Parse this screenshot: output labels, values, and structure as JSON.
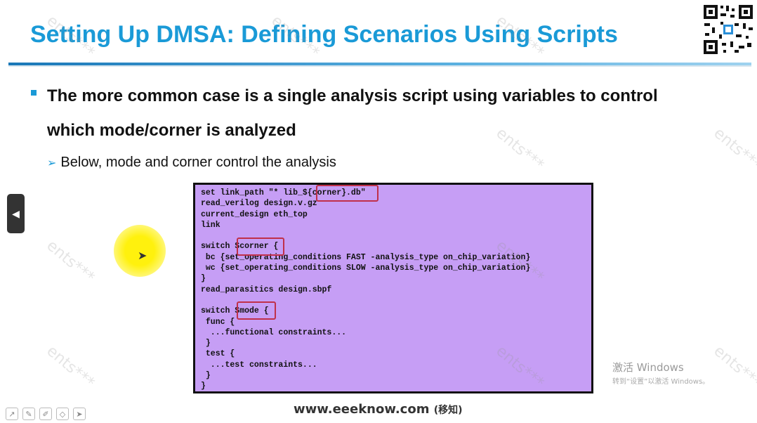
{
  "slide": {
    "title": "Setting Up DMSA: Defining Scenarios Using Scripts",
    "bullet_main": "The more common case is a single analysis script using variables to control which mode/corner is analyzed",
    "sub_bullet": "Below, mode and corner control the analysis"
  },
  "code_lines": [
    "set link_path \"* lib_${corner}.db\"",
    "read_verilog design.v.gz",
    "current_design eth_top",
    "link",
    "",
    "switch $corner {",
    " bc {set_operating_conditions FAST -analysis_type on_chip_variation}",
    " wc {set_operating_conditions SLOW -analysis_type on_chip_variation}",
    "}",
    "read_parasitics design.sbpf",
    "",
    "switch $mode {",
    " func {",
    "  ...functional constraints...",
    " }",
    " test {",
    "  ...test constraints...",
    " }",
    "}"
  ],
  "overlay": {
    "activate_title": "激活 Windows",
    "activate_sub": "转到“设置”以激活 Windows。",
    "footer_url": "www.eeeknow.com",
    "footer_tag": "(移知)"
  },
  "icons": {
    "nav_prev": "play-left-icon",
    "qr": "qr-code-icon"
  },
  "colors": {
    "title": "#1a9ad7",
    "code_bg": "#c69ef5",
    "highlight": "#c0304a"
  }
}
